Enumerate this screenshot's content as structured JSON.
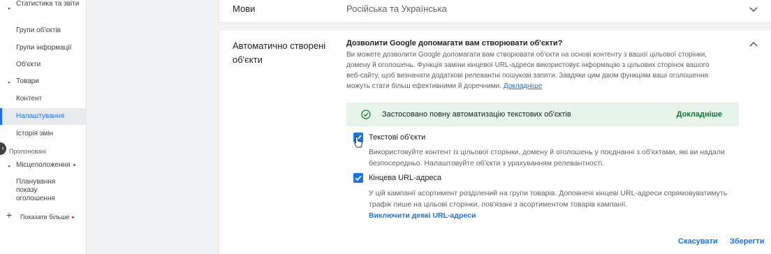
{
  "sidebar": {
    "items": [
      {
        "label": "Статистика та звіти",
        "caret": true
      },
      {
        "label": "Групи об'єктів"
      },
      {
        "label": "Групи інформації"
      },
      {
        "label": "Об'єкти"
      },
      {
        "label": "Товари",
        "caret": true
      },
      {
        "label": "Контент"
      },
      {
        "label": "Налаштування",
        "active": true
      },
      {
        "label": "Історія змін"
      }
    ],
    "section_label": "Пропоновані",
    "suggested": [
      {
        "label": "Місцеположення",
        "caret": true,
        "dot": true
      },
      {
        "label": "Планування показу оголошення"
      }
    ],
    "show_more": "Показати більше",
    "collapse_icon": "chevron-left-icon",
    "show_more_icon": "plus-icon"
  },
  "languages": {
    "label": "Мови",
    "value": "Російська та Українська"
  },
  "auto_assets": {
    "label": "Автоматично створені об'єкти",
    "question": "Дозволити Google допомагати вам створювати об'єкти?",
    "description": "Ви можете дозволити Google допомагати вам створювати об'єкти на основі контенту з вашої цільової сторінки, домену й оголошень. Функція заміни кінцевої URL-адреси використовує інформацію з цільових сторінок вашого веб-сайту, щоб визначати додаткові релевантні пошукові запити. Завдяки цим двом функціям ваші оголошення можуть стати більш ефективними й доречними.",
    "description_link": "Докладніше",
    "banner": {
      "text": "Застосовано повну автоматизацію текстових об'єктів",
      "link": "Докладніше"
    },
    "options": [
      {
        "title": "Текстові об'єкти",
        "checked": true,
        "description": "Використовуйте контент із цільової сторінки, домену й оголошень у поєднанні з об'єктами, які ви надали безпосередньо. Налаштовуйте об'єкти з урахуванням релевантності."
      },
      {
        "title": "Кінцева URL-адреса",
        "checked": true,
        "description": "У цій кампанії асортимент розділений на групи товарів. Доповнені кінцеві URL-адреси спрямовуватимуть трафік лише на цільові сторінки, пов'язані з асортиментом товарів кампанії.",
        "link": "Виключити деякі URL-адреси"
      }
    ]
  },
  "actions": {
    "cancel": "Скасувати",
    "save": "Зберегти"
  },
  "colors": {
    "accent": "#1a73e8",
    "banner_bg": "#e6f4ea",
    "success": "#137333",
    "notification_dot": "#d93025"
  }
}
